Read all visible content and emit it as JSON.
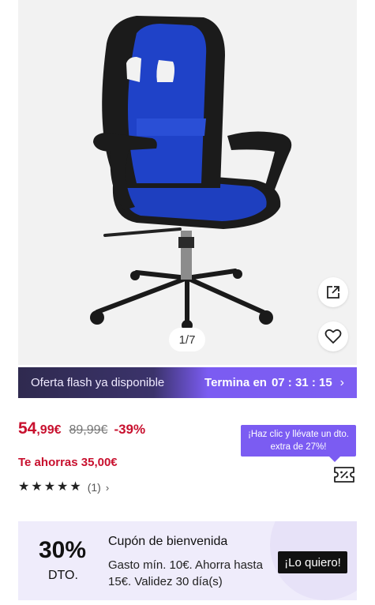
{
  "gallery": {
    "counter": "1/7",
    "image_subject": "office-chair-blue-black",
    "share_icon": "share-external-icon",
    "favorite_icon": "heart-outline-icon"
  },
  "flash": {
    "left_text": "Oferta flash ya disponible",
    "ends_label": "Termina en",
    "countdown": "07 : 31 : 15",
    "chevron_icon": "chevron-right-icon"
  },
  "price": {
    "integer": "54",
    "decimal": ",99€",
    "old_price": "89,99€",
    "discount": "-39%",
    "savings": "Te ahorras 35,00€"
  },
  "rating": {
    "stars": 5,
    "star_glyph": "★",
    "count": "(1)",
    "chevron": "›"
  },
  "promo": {
    "bubble_text": "¡Haz clic y llévate un dto. extra de 27%!",
    "coupon_icon": "ticket-percent-icon"
  },
  "welcome_coupon": {
    "percent": "30%",
    "dto": "DTO.",
    "title": "Cupón de bienvenida",
    "description": "Gasto mín. 10€. Ahorra hasta 15€. Validez 30 día(s)",
    "cta": "¡Lo quiero!"
  },
  "colors": {
    "price_red": "#c8102e",
    "accent_purple": "#7b5cf2",
    "flash_dark": "#2f2a4f",
    "coupon_bg": "#efecfb"
  }
}
